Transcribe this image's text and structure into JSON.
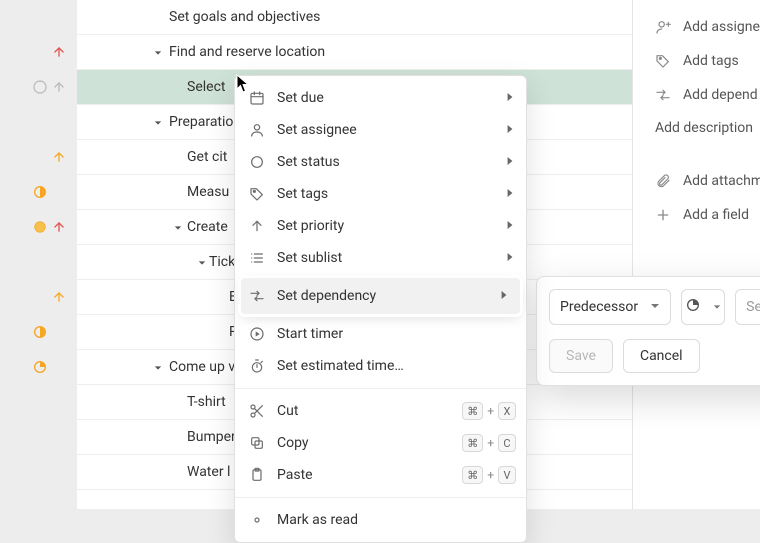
{
  "tasks": [
    {
      "label": "Set goals and objectives"
    },
    {
      "label": "Find and reserve location"
    },
    {
      "label": "Select"
    },
    {
      "label": "Preparatio"
    },
    {
      "label": "Get cit"
    },
    {
      "label": "Measu"
    },
    {
      "label": "Create"
    },
    {
      "label": "Tick"
    },
    {
      "label": "E"
    },
    {
      "label": "Rec"
    },
    {
      "label": "Come up v"
    },
    {
      "label": "T-shirt"
    },
    {
      "label": "Bumper"
    },
    {
      "label": "Water l"
    }
  ],
  "context_menu": {
    "set_due": "Set due",
    "set_assignee": "Set assignee",
    "set_status": "Set status",
    "set_tags": "Set tags",
    "set_priority": "Set priority",
    "set_sublist": "Set sublist",
    "set_dependency": "Set dependency",
    "start_timer": "Start timer",
    "set_estimated": "Set estimated time…",
    "cut": "Cut",
    "copy": "Copy",
    "paste": "Paste",
    "mark_as_read": "Mark as read",
    "shortcut_cmd": "⌘",
    "shortcut_plus": "+",
    "shortcut_x": "X",
    "shortcut_c": "C",
    "shortcut_v": "V"
  },
  "side_panel": {
    "add_assignee": "Add assigne",
    "add_tags": "Add tags",
    "add_dependency": "Add depend",
    "add_description": "Add description",
    "add_attachment": "Add attachm",
    "add_field": "Add a field"
  },
  "dep_popover": {
    "type_label": "Predecessor",
    "search_placeholder": "Sele",
    "save": "Save",
    "cancel": "Cancel"
  },
  "colors": {
    "accent_bg": "#cfe2d7",
    "orange": "#f5a623",
    "red": "#e2504e"
  }
}
